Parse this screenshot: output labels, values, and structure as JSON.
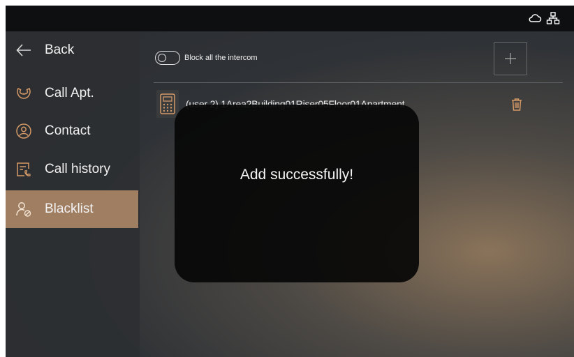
{
  "topbar": {
    "cloud_icon": "cloud-icon",
    "network_icon": "network-icon"
  },
  "sidebar": {
    "items": [
      {
        "label": "Back",
        "icon": "back-arrow-icon"
      },
      {
        "label": "Call Apt.",
        "icon": "call-icon"
      },
      {
        "label": "Contact",
        "icon": "contact-icon"
      },
      {
        "label": "Call history",
        "icon": "call-history-icon"
      },
      {
        "label": "Blacklist",
        "icon": "blacklist-icon",
        "active": true
      }
    ]
  },
  "main": {
    "toggle_label": "Block all the intercom",
    "toggle_on": false,
    "add_button_icon": "plus-icon",
    "entries": [
      {
        "text": "(user 2) 1Area2Building01Riser05Floor01Apartment",
        "icon": "intercom-device-icon",
        "delete_icon": "trash-icon"
      }
    ]
  },
  "toast": {
    "message": "Add successfully!"
  },
  "colors": {
    "accent": "#a07e62",
    "delete": "#d49a67",
    "sidebar": "#2d2f32"
  }
}
